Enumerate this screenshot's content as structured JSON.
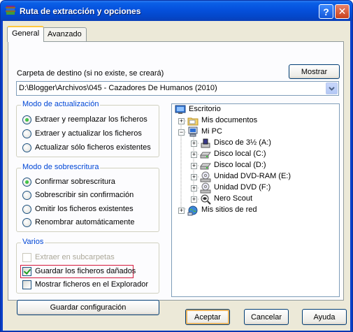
{
  "window": {
    "title": "Ruta de extracción y opciones"
  },
  "titlebar": {
    "help_glyph": "?",
    "close_glyph": "✕"
  },
  "tabs": [
    {
      "label": "General",
      "selected": true
    },
    {
      "label": "Avanzado",
      "selected": false
    }
  ],
  "destination": {
    "label": "Carpeta de destino (si no existe, se creará)",
    "show_button": "Mostrar",
    "path": "D:\\Blogger\\Archivos\\045 - Cazadores De Humanos (2010)"
  },
  "update_mode": {
    "title": "Modo de actualización",
    "options": [
      {
        "label": "Extraer y reemplazar los ficheros",
        "selected": true
      },
      {
        "label": "Extraer y actualizar los ficheros",
        "selected": false
      },
      {
        "label": "Actualizar sólo ficheros existentes",
        "selected": false
      }
    ]
  },
  "overwrite_mode": {
    "title": "Modo de sobrescritura",
    "options": [
      {
        "label": "Confirmar sobrescritura",
        "selected": true
      },
      {
        "label": "Sobrescribir sin confirmación",
        "selected": false
      },
      {
        "label": "Omitir los ficheros existentes",
        "selected": false
      },
      {
        "label": "Renombrar automáticamente",
        "selected": false
      }
    ]
  },
  "misc": {
    "title": "Varios",
    "options": [
      {
        "label": "Extraer en subcarpetas",
        "checked": false,
        "enabled": false
      },
      {
        "label": "Guardar los ficheros dañados",
        "checked": true,
        "enabled": true
      },
      {
        "label": "Mostrar ficheros en el Explorador",
        "checked": false,
        "enabled": true
      }
    ]
  },
  "save_settings_button": "Guardar configuración",
  "tree": {
    "nodes": [
      {
        "label": "Escritorio",
        "icon": "desktop-icon",
        "expander": ""
      },
      {
        "label": "Mis documentos",
        "icon": "folder-icon",
        "expander": "+"
      },
      {
        "label": "Mi PC",
        "icon": "computer-icon",
        "expander": "−"
      },
      {
        "label": "Disco de 3½ (A:)",
        "icon": "floppy-icon",
        "expander": "+"
      },
      {
        "label": "Disco local (C:)",
        "icon": "hard-drive-icon",
        "expander": "+"
      },
      {
        "label": "Disco local (D:)",
        "icon": "hard-drive-icon",
        "expander": "+"
      },
      {
        "label": "Unidad DVD-RAM (E:)",
        "icon": "dvd-drive-icon",
        "expander": "+"
      },
      {
        "label": "Unidad DVD (F:)",
        "icon": "dvd-drive-icon",
        "expander": "+"
      },
      {
        "label": "Nero Scout",
        "icon": "nero-scout-icon",
        "expander": "+"
      },
      {
        "label": "Mis sitios de red",
        "icon": "network-icon",
        "expander": "+"
      }
    ]
  },
  "footer": {
    "ok": "Aceptar",
    "cancel": "Cancelar",
    "help": "Ayuda"
  },
  "colors": {
    "group_title": "#0046d5",
    "title_bar": "#0550dc",
    "focus_outline": "#d4183c"
  }
}
